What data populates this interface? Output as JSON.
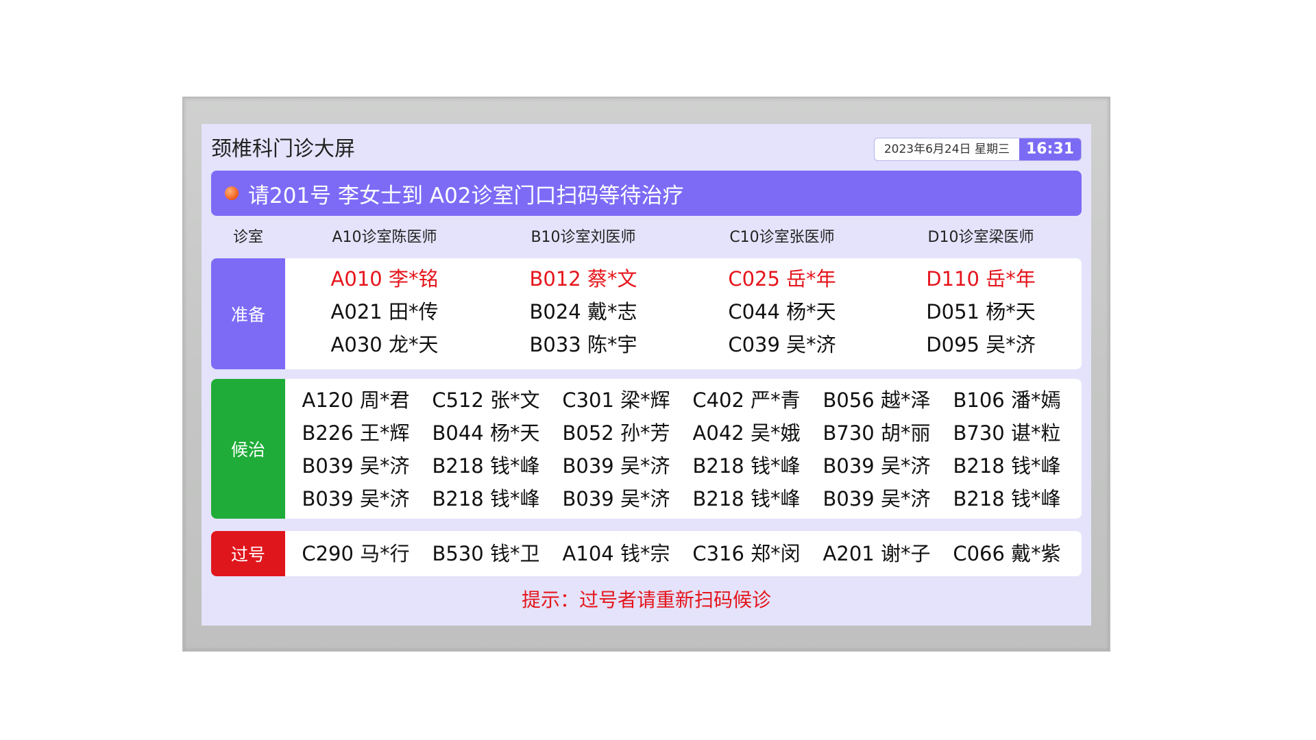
{
  "screen": {
    "title": "颈椎科门诊大屏",
    "date": "2023年6月24日  星期三",
    "time": "16:31"
  },
  "banner": {
    "text": "请201号 李女士到 A02诊室门口扫码等待治疗"
  },
  "header": {
    "label": "诊室",
    "rooms": [
      "A10诊室陈医师",
      "B10诊室刘医师",
      "C10诊室张医师",
      "D10诊室梁医师"
    ]
  },
  "ready": {
    "label": "准备",
    "color": "#7d6bf6",
    "current_color": "#e5141b",
    "columns": [
      [
        "A010 李*铭",
        "A021 田*传",
        "A030 龙*天"
      ],
      [
        "B012 蔡*文",
        "B024 戴*志",
        "B033 陈*宇"
      ],
      [
        "C025 岳*年",
        "C044 杨*天",
        "C039 吴*济"
      ],
      [
        "D110 岳*年",
        "D051 杨*天",
        "D095 吴*济"
      ]
    ]
  },
  "waiting": {
    "label": "候治",
    "color": "#1fac38",
    "rows": [
      [
        "A120 周*君",
        "C512 张*文",
        "C301 梁*辉",
        "C402 严*青",
        "B056 越*泽",
        "B106 潘*嫣"
      ],
      [
        "B226 王*辉",
        "B044 杨*天",
        "B052 孙*芳",
        "A042 吴*娥",
        "B730 胡*丽",
        "B730 谌*粒"
      ],
      [
        "B039 吴*济",
        "B218 钱*峰",
        "B039 吴*济",
        "B218 钱*峰",
        "B039 吴*济",
        "B218 钱*峰"
      ],
      [
        "B039 吴*济",
        "B218 钱*峰",
        "B039 吴*济",
        "B218 钱*峰",
        "B039 吴*济",
        "B218 钱*峰"
      ]
    ]
  },
  "missed": {
    "label": "过号",
    "color": "#e0161d",
    "items": [
      "C290 马*行",
      "B530 钱*卫",
      "A104 钱*宗",
      "C316 郑*闵",
      "A201 谢*子",
      "C066 戴*紫"
    ]
  },
  "tip": {
    "text": "提示：过号者请重新扫码候诊"
  }
}
